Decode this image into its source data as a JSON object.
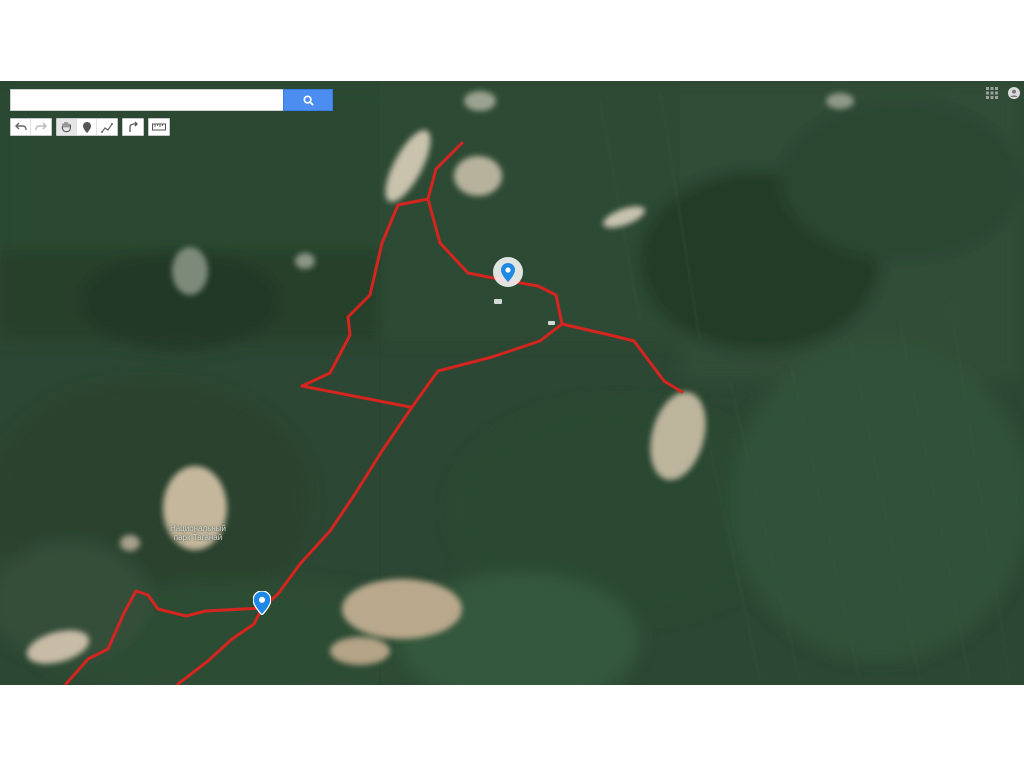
{
  "search": {
    "placeholder": "",
    "value": "",
    "button_icon": "search-icon"
  },
  "toolbar": {
    "tools": [
      {
        "icon": "undo-icon"
      },
      {
        "icon": "redo-icon"
      },
      {
        "icon": "hand-pan-icon"
      },
      {
        "icon": "add-marker-icon"
      },
      {
        "icon": "draw-line-icon"
      },
      {
        "icon": "directions-icon"
      },
      {
        "icon": "measure-ruler-icon"
      }
    ]
  },
  "top_right": {
    "apps_icon": "apps-grid-icon",
    "account_icon": "account-icon"
  },
  "map": {
    "type": "satellite",
    "labels": {
      "park_line1": "Национальный",
      "park_line2": "парк Таганай"
    },
    "markers": [
      {
        "name": "marker-highlighted",
        "icon": "map-pin-icon",
        "color": "#1e88e5"
      },
      {
        "name": "marker-start",
        "icon": "map-pin-icon",
        "color": "#1e88e5"
      }
    ],
    "route_color": "#e0231f"
  }
}
